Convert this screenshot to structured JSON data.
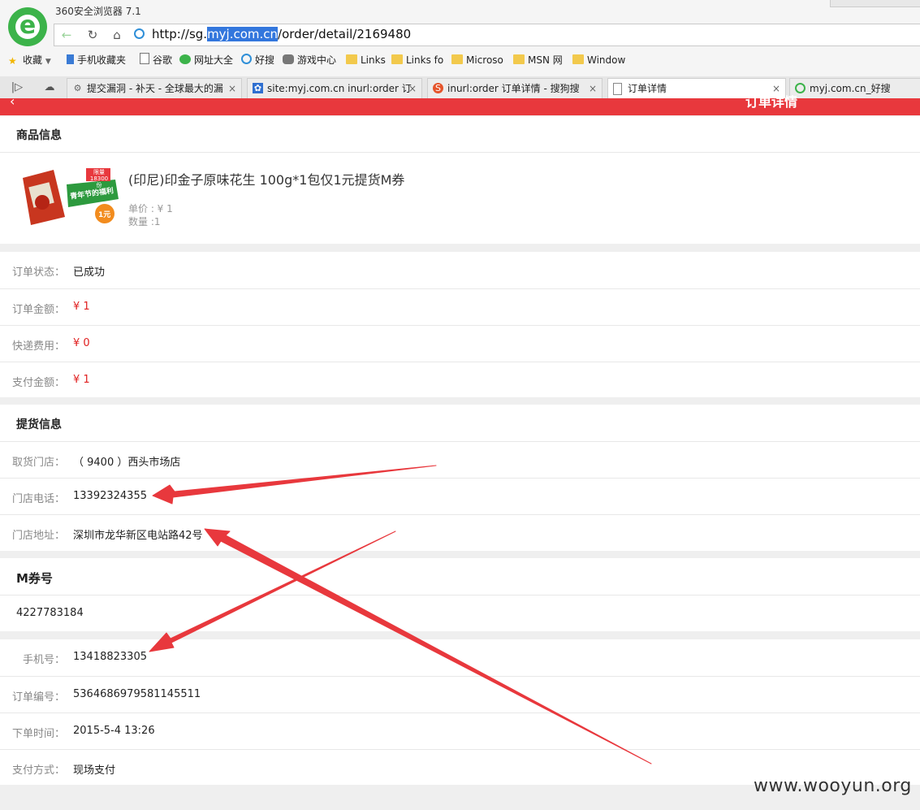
{
  "browser": {
    "app_title": "360安全浏览器 7.1",
    "logo_letter": "e",
    "url": {
      "prefix": "http://sg.",
      "highlighted": "myj.com.cn",
      "suffix": "/order/detail/2169480"
    },
    "bookmarks": [
      "收藏",
      "手机收藏夹",
      "谷歌",
      "网址大全",
      "好搜",
      "游戏中心",
      "Links",
      "Links fo",
      "Microso",
      "MSN 网",
      "Window"
    ],
    "tabs": [
      {
        "label": "提交漏洞 - 补天 - 全球最大的漏"
      },
      {
        "label": "site:myj.com.cn inurl:order 订"
      },
      {
        "label": "inurl:order 订单详情 - 搜狗搜"
      },
      {
        "label": "订单详情",
        "active": true
      },
      {
        "label": "myj.com.cn_好搜"
      }
    ],
    "tab_close": "×"
  },
  "page": {
    "header_title": "订单详情",
    "back_glyph": "‹",
    "product_section": {
      "title": "商品信息",
      "image_text": {
        "badge": "限量 18300份",
        "banner": "青年节的福利",
        "coupon": "1元"
      },
      "name": "(印尼)印金子原味花生 100g*1包仅1元提货M券",
      "unit_price": "单价 : ¥ 1",
      "quantity": "数量 :1"
    },
    "order_summary": [
      {
        "label": "订单状态：",
        "value": "已成功",
        "red": false
      },
      {
        "label": "订单金额：",
        "value": "¥ 1",
        "red": true
      },
      {
        "label": "快递费用：",
        "value": "¥ 0",
        "red": true
      },
      {
        "label": "支付金额：",
        "value": "¥ 1",
        "red": true
      }
    ],
    "pickup_section": {
      "title": "提货信息",
      "rows": [
        {
          "label": "取货门店：",
          "value": "（ 9400 ）西头市场店"
        },
        {
          "label": "门店电话：",
          "value": "13392324355"
        },
        {
          "label": "门店地址：",
          "value": "深圳市龙华新区电站路42号"
        }
      ]
    },
    "coupon_section": {
      "title": "M券号",
      "code": "4227783184"
    },
    "order_info": [
      {
        "label": "手机号：",
        "value": "13418823305"
      },
      {
        "label": "订单编号：",
        "value": "5364686979581145511"
      },
      {
        "label": "下单时间：",
        "value": "2015-5-4 13:26"
      },
      {
        "label": "支付方式：",
        "value": "现场支付"
      }
    ]
  },
  "watermark": "www.wooyun.org",
  "colors": {
    "header_red": "#e8383d",
    "price_red": "#e02020",
    "arrow_red": "#e8383d",
    "logo_green": "#3cb34a"
  }
}
